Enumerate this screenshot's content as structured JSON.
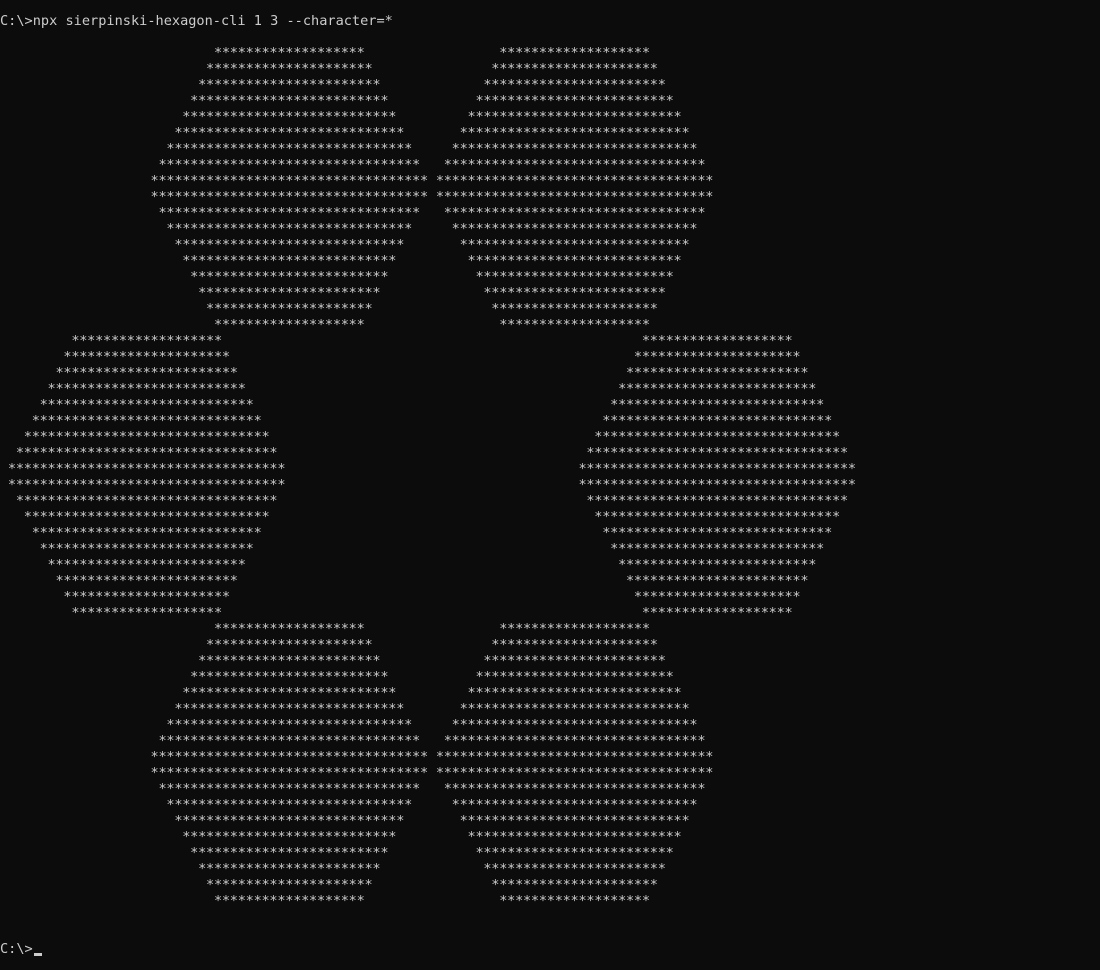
{
  "terminal": {
    "prompt": "C:\\>",
    "command": "npx sierpinski-hexagon-cli 1 3 --character=*",
    "output_char": "*",
    "final_prompt": "C:\\>"
  },
  "colors": {
    "background": "#0c0c0c",
    "foreground": "#cccccc"
  }
}
